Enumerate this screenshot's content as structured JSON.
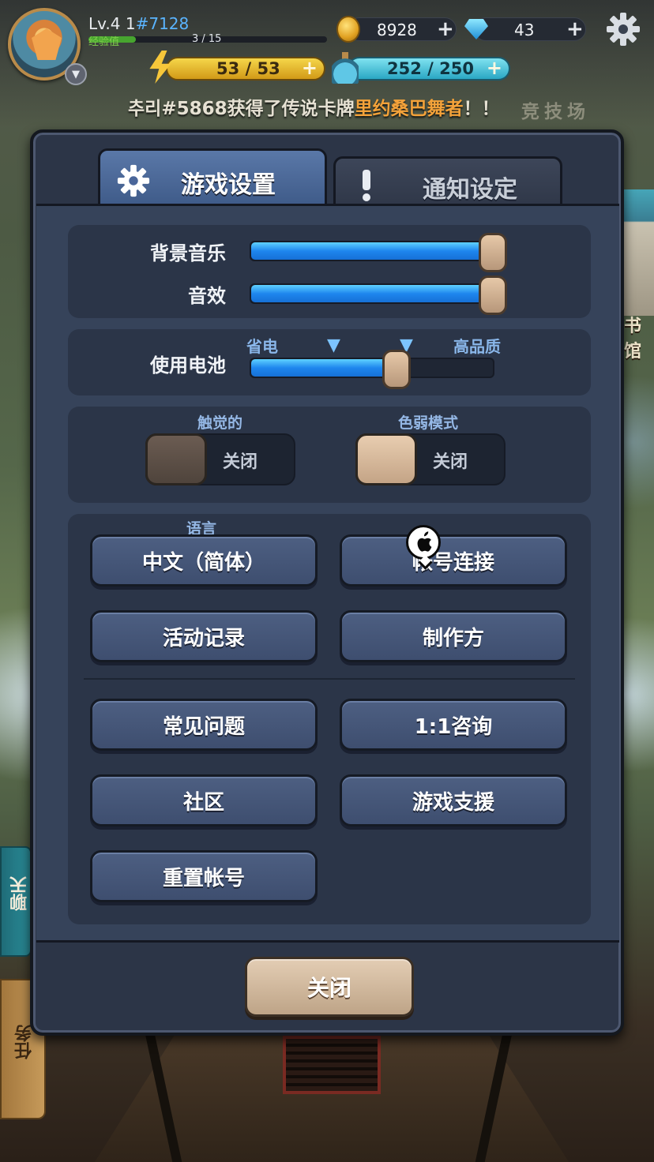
{
  "hud": {
    "level": "Lv.4 1",
    "player_tag": "#7128",
    "exp_label": "经验值",
    "exp_value": "3 / 15",
    "exp_progress": 0.2,
    "gold": "8928",
    "gems": "43",
    "stamina": "53 / 53",
    "mana": "252 / 250",
    "plus": "+",
    "avatar_dropdown": "▼"
  },
  "ticker": {
    "prefix": "추리#5868获得了传说卡牌",
    "highlight": "里约桑巴舞者",
    "suffix": "！！",
    "tail": "竞技场"
  },
  "background": {
    "library_label": "书馆"
  },
  "side_tabs": {
    "chat": "聊天",
    "task": "任务"
  },
  "tabs": {
    "game_settings": "游戏设置",
    "notification_settings": "通知设定"
  },
  "audio": {
    "music_label": "背景音乐",
    "music_level": 1.0,
    "sfx_label": "音效",
    "sfx_level": 1.0
  },
  "battery": {
    "label": "使用电池",
    "low_label": "省电",
    "high_label": "高品质",
    "marker": "▼",
    "level": 0.6
  },
  "toggles": {
    "haptic_caption": "触觉的",
    "haptic_state": "关闭",
    "colorblind_caption": "色弱模式",
    "colorblind_state": "关闭"
  },
  "buttons": {
    "language_caption": "语言",
    "language": "中文（简体）",
    "account_link": "帐号连接",
    "activity_log": "活动记录",
    "credits": "制作方",
    "faq": "常见问题",
    "consult": "1:1咨询",
    "community": "社区",
    "game_support": "游戏支援",
    "reset_account": "重置帐号"
  },
  "footer": {
    "close": "关闭"
  },
  "colors": {
    "panel_bg": "#2c3547",
    "section_bg": "#2b3548",
    "button_bg": "#4d5f82",
    "slider_fill": "#1e86ee",
    "accent_link": "#5ab4ff",
    "ticker_highlight": "#f3a23a"
  }
}
